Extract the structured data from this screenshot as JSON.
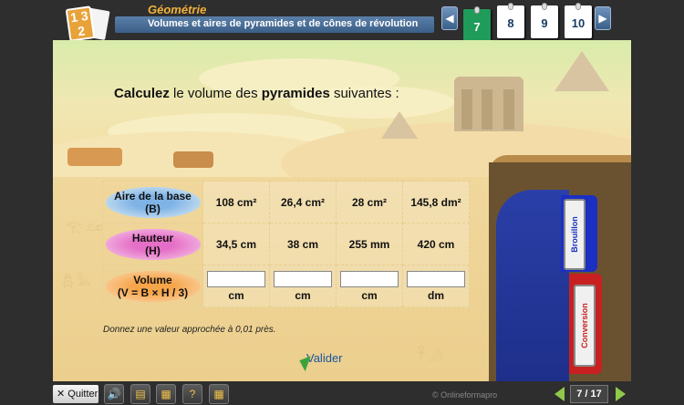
{
  "header": {
    "subject": "Géométrie",
    "chapter": "Volumes et aires de pyramides et de cônes de révolution",
    "logo_text": "1 3 2",
    "pages": [
      {
        "label": "7",
        "active": true
      },
      {
        "label": "8",
        "active": false
      },
      {
        "label": "9",
        "active": false
      },
      {
        "label": "10",
        "active": false
      }
    ],
    "prev_icon": "chevron-left-icon",
    "next_icon": "chevron-right-icon"
  },
  "exercise": {
    "instruction_bold_1": "Calculez",
    "instruction_mid": " le volume des ",
    "instruction_bold_2": "pyramides",
    "instruction_end": " suivantes :",
    "rows": {
      "base": {
        "label_line1": "Aire de la base",
        "label_line2": "(B)",
        "values": [
          "108 cm²",
          "26,4 cm²",
          "28 cm²",
          "145,8 dm²"
        ]
      },
      "height": {
        "label_line1": "Hauteur",
        "label_line2": "(H)",
        "values": [
          "34,5 cm",
          "38 cm",
          "255 mm",
          "420 cm"
        ]
      },
      "volume": {
        "label_line1": "Volume",
        "label_line2": "(V = B × H / 3)",
        "inputs": [
          "",
          "",
          "",
          ""
        ],
        "units": [
          "cm",
          "cm",
          "cm",
          "dm"
        ]
      }
    },
    "note": "Donnez une valeur approchée à 0,01 près.",
    "validate_label": "Valider"
  },
  "side_tabs": {
    "brouillon": "Brouillon",
    "conversion": "Conversion"
  },
  "footer": {
    "quit_label": "Quitter",
    "tools": [
      "speaker-icon",
      "document-icon",
      "book-icon",
      "help-icon",
      "calculator-icon"
    ],
    "copyright": "© Onlineformapro",
    "page_counter": "7 / 17"
  },
  "colors": {
    "accent_gold": "#f2b13a",
    "chapter_blue": "#3b5f87",
    "active_page_green": "#1f9b5a",
    "nav_green": "#8fc84a"
  }
}
